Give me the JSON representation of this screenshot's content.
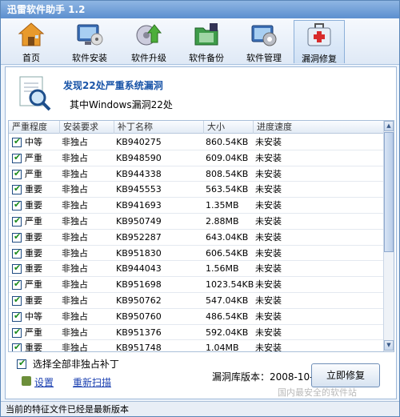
{
  "title": "迅雷软件助手 1.2",
  "toolbar": {
    "items": [
      {
        "label": "首页",
        "icon": "home-icon"
      },
      {
        "label": "软件安装",
        "icon": "monitor-install-icon"
      },
      {
        "label": "软件升级",
        "icon": "upgrade-icon"
      },
      {
        "label": "软件备份",
        "icon": "backup-folder-icon"
      },
      {
        "label": "软件管理",
        "icon": "manage-gear-icon"
      },
      {
        "label": "漏洞修复",
        "icon": "first-aid-kit-icon"
      }
    ],
    "active": "漏洞修复"
  },
  "header": {
    "title": "发现22处严重系统漏洞",
    "subtitle": "其中Windows漏洞22处"
  },
  "table": {
    "columns": [
      "严重程度",
      "安装要求",
      "补丁名称",
      "大小",
      "进度速度"
    ],
    "rows": [
      {
        "severity": "中等",
        "req": "非独占",
        "name": "KB940275",
        "size": "860.54KB",
        "status": "未安装"
      },
      {
        "severity": "严重",
        "req": "非独占",
        "name": "KB948590",
        "size": "609.04KB",
        "status": "未安装"
      },
      {
        "severity": "严重",
        "req": "非独占",
        "name": "KB944338",
        "size": "808.54KB",
        "status": "未安装"
      },
      {
        "severity": "重要",
        "req": "非独占",
        "name": "KB945553",
        "size": "563.54KB",
        "status": "未安装"
      },
      {
        "severity": "重要",
        "req": "非独占",
        "name": "KB941693",
        "size": "1.35MB",
        "status": "未安装"
      },
      {
        "severity": "严重",
        "req": "非独占",
        "name": "KB950749",
        "size": "2.88MB",
        "status": "未安装"
      },
      {
        "severity": "重要",
        "req": "非独占",
        "name": "KB952287",
        "size": "643.04KB",
        "status": "未安装"
      },
      {
        "severity": "重要",
        "req": "非独占",
        "name": "KB951830",
        "size": "606.54KB",
        "status": "未安装"
      },
      {
        "severity": "重要",
        "req": "非独占",
        "name": "KB944043",
        "size": "1.56MB",
        "status": "未安装"
      },
      {
        "severity": "严重",
        "req": "非独占",
        "name": "KB951698",
        "size": "1023.54KB",
        "status": "未安装"
      },
      {
        "severity": "重要",
        "req": "非独占",
        "name": "KB950762",
        "size": "547.04KB",
        "status": "未安装"
      },
      {
        "severity": "中等",
        "req": "非独占",
        "name": "KB950760",
        "size": "486.54KB",
        "status": "未安装"
      },
      {
        "severity": "严重",
        "req": "非独占",
        "name": "KB951376",
        "size": "592.04KB",
        "status": "未安装"
      },
      {
        "severity": "重要",
        "req": "非独占",
        "name": "KB951748",
        "size": "1.04MB",
        "status": "未安装"
      }
    ]
  },
  "footer": {
    "select_all_label": "选择全部非独占补丁",
    "settings_label": "设置",
    "rescan_label": "重新扫描",
    "lib_version": "漏洞库版本：2008-10-6",
    "fix_button": "立即修复",
    "watermark": "国内最安全的软件站"
  },
  "status_text": "当前的特征文件已经是最新版本",
  "colors": {
    "accent": "#1a55a8",
    "link": "#1a3fb0",
    "check": "#1a8a1a"
  }
}
